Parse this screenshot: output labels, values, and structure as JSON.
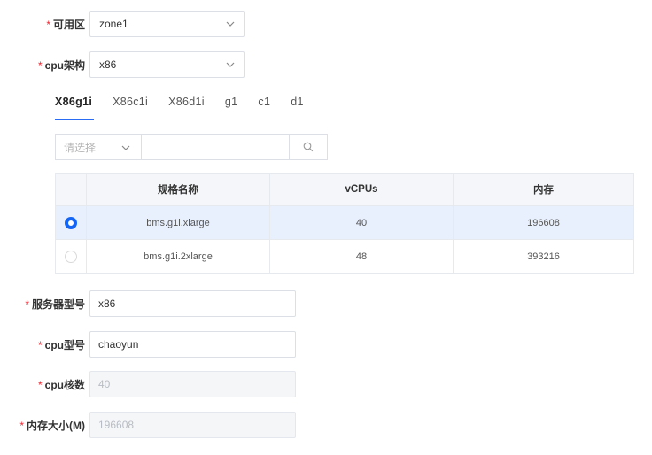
{
  "form": {
    "zone": {
      "label": "可用区",
      "required_mark": "*",
      "value": "zone1"
    },
    "arch": {
      "label": "cpu架构",
      "required_mark": "*",
      "value": "x86"
    },
    "server_model": {
      "label": "服务器型号",
      "required_mark": "*",
      "value": "x86"
    },
    "cpu_model": {
      "label": "cpu型号",
      "required_mark": "*",
      "value": "chaoyun"
    },
    "cpu_cores": {
      "label": "cpu核数",
      "required_mark": "*",
      "value": "40"
    },
    "memory": {
      "label": "内存大小(M)",
      "required_mark": "*",
      "value": "196608"
    }
  },
  "tabs": [
    {
      "label": "X86g1i",
      "active": true
    },
    {
      "label": "X86c1i",
      "active": false
    },
    {
      "label": "X86d1i",
      "active": false
    },
    {
      "label": "g1",
      "active": false
    },
    {
      "label": "c1",
      "active": false
    },
    {
      "label": "d1",
      "active": false
    }
  ],
  "filter": {
    "select_placeholder": "请选择",
    "search_value": ""
  },
  "table": {
    "headers": {
      "name": "规格名称",
      "vcpus": "vCPUs",
      "memory": "内存"
    },
    "rows": [
      {
        "name": "bms.g1i.xlarge",
        "vcpus": "40",
        "memory": "196608",
        "selected": true
      },
      {
        "name": "bms.g1i.2xlarge",
        "vcpus": "48",
        "memory": "393216",
        "selected": false
      }
    ]
  },
  "icons": {
    "chevron": "chevron-down-icon",
    "search": "search-icon"
  },
  "colors": {
    "accent": "#1565f5",
    "required": "#f5222d",
    "selected_row": "#e9f0fd"
  }
}
